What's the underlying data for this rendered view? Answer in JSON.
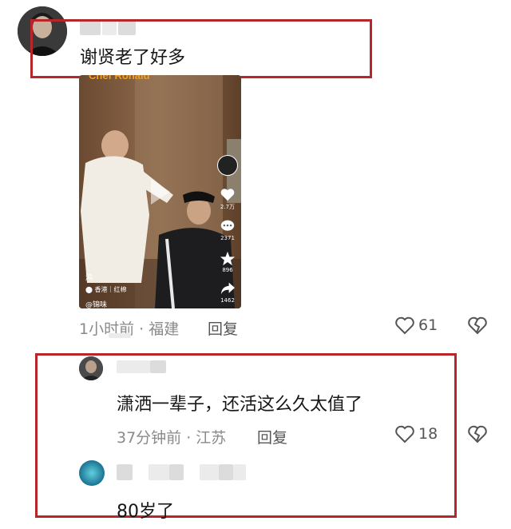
{
  "comment1": {
    "text": "谢贤老了好多",
    "meta": "1小时前 · 福建",
    "reply_label": "回复",
    "likes": "61",
    "video": {
      "caption_top": "Chef Ronald",
      "location": "香港｜红棉",
      "side_likes": "2.7万",
      "side_comments": "2371",
      "side_favorites": "896",
      "side_shares": "1462",
      "tag": "锦味",
      "left_mark": "鸿"
    }
  },
  "reply1": {
    "text": "潇洒一辈子，还活这么久太值了",
    "meta": "37分钟前 · 江苏",
    "reply_label": "回复",
    "likes": "18"
  },
  "reply2": {
    "text": "80岁了"
  },
  "colors": {
    "highlight_border": "#b8262b",
    "meta_text": "#8a8a8a"
  },
  "icons": {
    "like": "heart-outline-icon",
    "dislike": "broken-heart-icon",
    "play": "play-icon"
  }
}
